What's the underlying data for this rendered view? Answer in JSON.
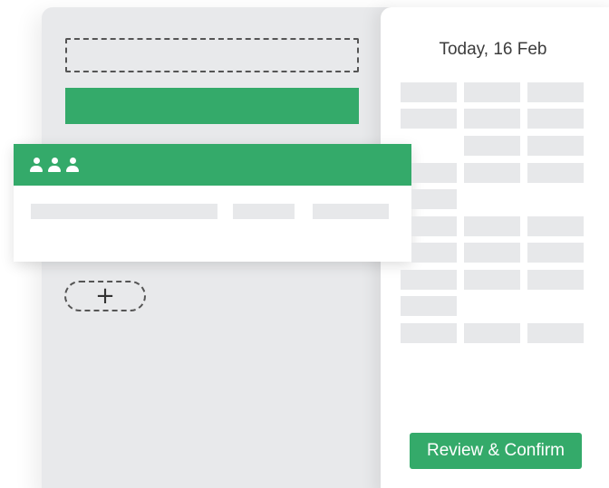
{
  "schedule": {
    "date_label": "Today, 16 Feb"
  },
  "actions": {
    "add_label": "+",
    "review_label": "Review & Confirm"
  },
  "card": {
    "icons": [
      "person-icon",
      "person-icon",
      "person-icon"
    ]
  },
  "colors": {
    "accent": "#34aa6a",
    "panel_background": "#e8e9eb",
    "placeholder": "#e7e8ea"
  }
}
